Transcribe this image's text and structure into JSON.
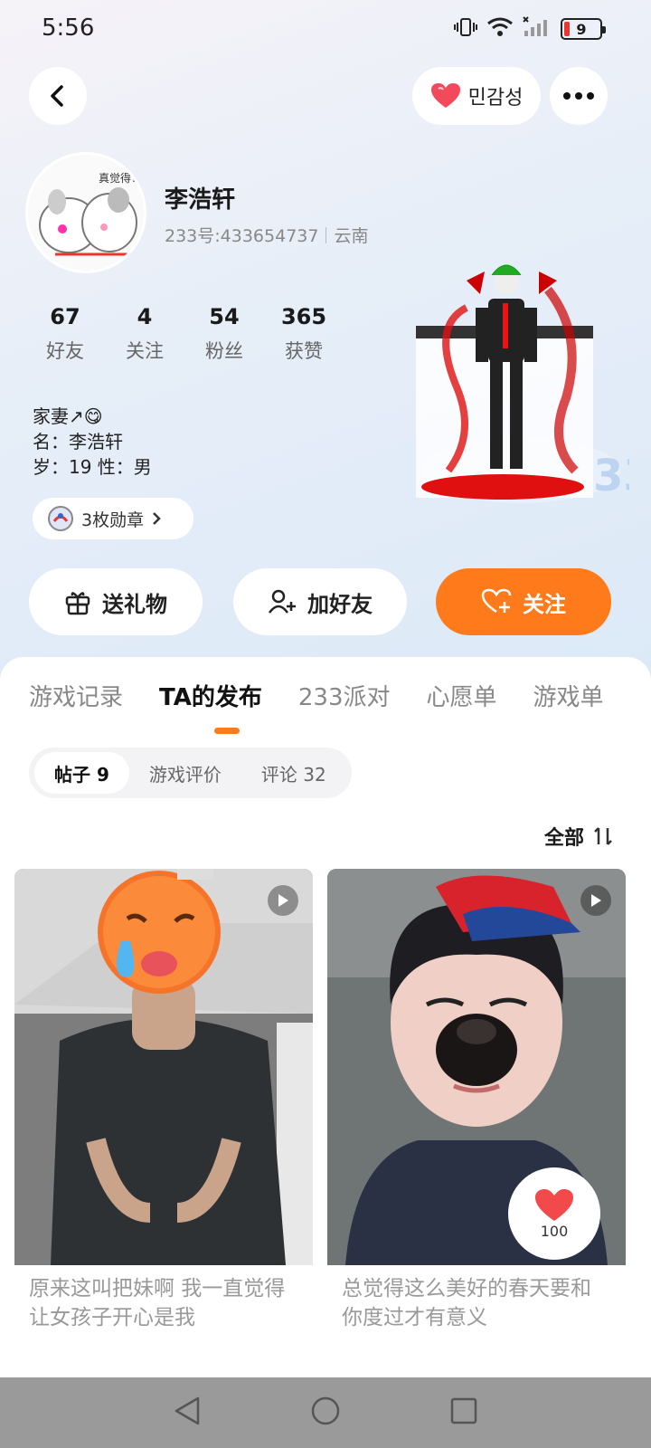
{
  "status": {
    "time": "5:56",
    "battery": "9"
  },
  "header": {
    "badge_label": "민감성"
  },
  "profile": {
    "name": "李浩轩",
    "uid": "233号:433654737",
    "region": "云南",
    "stats": [
      {
        "num": "67",
        "label": "好友"
      },
      {
        "num": "4",
        "label": "关注"
      },
      {
        "num": "54",
        "label": "粉丝"
      },
      {
        "num": "365",
        "label": "获赞"
      }
    ],
    "bio": [
      "家妻↗😋",
      "名：李浩轩",
      "岁：19 性：男"
    ],
    "medals": "3枚勋章"
  },
  "actions": {
    "gift": "送礼物",
    "add_friend": "加好友",
    "follow": "关注"
  },
  "tabs": [
    "游戏记录",
    "TA的发布",
    "233派对",
    "心愿单",
    "游戏单"
  ],
  "subtabs": [
    "帖子 9",
    "游戏评价",
    "评论 32"
  ],
  "sort_label": "全部",
  "posts": [
    {
      "title": "原来这叫把妹啊 我一直觉得让女孩子开心是我"
    },
    {
      "title": "总觉得这么美好的春天要和你度过才有意义",
      "likes": "100"
    }
  ],
  "colors": {
    "accent": "#ff7a1a",
    "like": "#f24a5b"
  }
}
